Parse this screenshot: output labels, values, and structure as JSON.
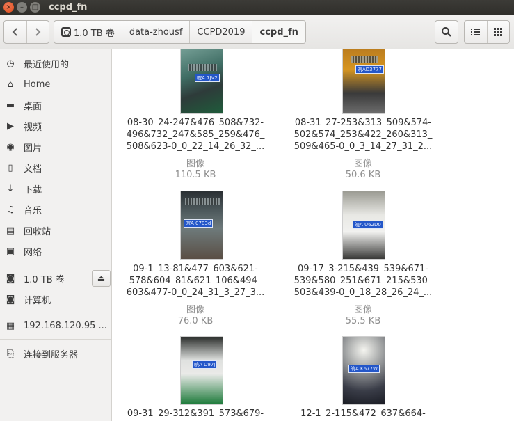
{
  "window": {
    "title": "ccpd_fn",
    "close_glyph": "×",
    "min_glyph": "–",
    "max_glyph": "□"
  },
  "toolbar": {
    "back_icon": "chevron-left-icon",
    "forward_icon": "chevron-right-icon",
    "breadcrumbs": [
      {
        "label": "1.0 TB 卷",
        "icon": "drive-icon"
      },
      {
        "label": "data-zhousf"
      },
      {
        "label": "CCPD2019"
      },
      {
        "label": "ccpd_fn",
        "active": true
      }
    ],
    "search_icon": "search-icon",
    "list_view_icon": "list-view-icon",
    "grid_view_icon": "grid-view-icon"
  },
  "sidebar": {
    "places": [
      {
        "label": "最近使用的",
        "icon": "clock-icon",
        "glyph": "◷"
      },
      {
        "label": "Home",
        "icon": "home-icon",
        "glyph": "⌂"
      },
      {
        "label": "桌面",
        "icon": "folder-icon",
        "glyph": "▬"
      },
      {
        "label": "视频",
        "icon": "video-icon",
        "glyph": "▶"
      },
      {
        "label": "图片",
        "icon": "camera-icon",
        "glyph": "◉"
      },
      {
        "label": "文档",
        "icon": "document-icon",
        "glyph": "▯"
      },
      {
        "label": "下载",
        "icon": "download-icon",
        "glyph": "↓"
      },
      {
        "label": "音乐",
        "icon": "music-icon",
        "glyph": "♫"
      },
      {
        "label": "回收站",
        "icon": "trash-icon",
        "glyph": "▤"
      },
      {
        "label": "网络",
        "icon": "network-icon",
        "glyph": "▣"
      }
    ],
    "devices": [
      {
        "label": "1.0 TB 卷",
        "icon": "drive-icon",
        "glyph": "◙",
        "eject": "⏏"
      },
      {
        "label": "计算机",
        "icon": "computer-icon",
        "glyph": "◙"
      }
    ],
    "network": [
      {
        "label": "192.168.120.95 ...",
        "icon": "server-icon",
        "glyph": "▦"
      }
    ],
    "connect": {
      "label": "连接到服务器",
      "icon": "connect-server-icon",
      "glyph": "⎘"
    }
  },
  "files": [
    {
      "name_lines": [
        "08-30_24-247&476_508&732-",
        "496&732_247&585_259&476_",
        "508&623-0_0_22_14_26_32_..."
      ],
      "type": "图像",
      "size": "110.5 KB",
      "plate": "皖A 7JV2"
    },
    {
      "name_lines": [
        "08-31_27-253&313_509&574-",
        "502&574_253&422_260&313_",
        "509&465-0_0_3_14_27_31_2..."
      ],
      "type": "图像",
      "size": "50.6 KB",
      "plate": "皖AD3777"
    },
    {
      "name_lines": [
        "09-1_13-81&477_603&621-",
        "578&604_81&621_106&494_",
        "603&477-0_0_24_31_3_27_3..."
      ],
      "type": "图像",
      "size": "76.0 KB",
      "plate": "皖A 0703d"
    },
    {
      "name_lines": [
        "09-17_3-215&439_539&671-",
        "539&580_251&671_215&530_",
        "503&439-0_0_18_28_26_24_..."
      ],
      "type": "图像",
      "size": "55.5 KB",
      "plate": "皖A U62D0"
    },
    {
      "name_lines": [
        "09-31_29-312&391_573&679-"
      ],
      "type": "",
      "size": "",
      "plate": "皖A D97J"
    },
    {
      "name_lines": [
        "12-1_2-115&472_637&664-"
      ],
      "type": "",
      "size": "",
      "plate": "皖A K677W"
    }
  ]
}
